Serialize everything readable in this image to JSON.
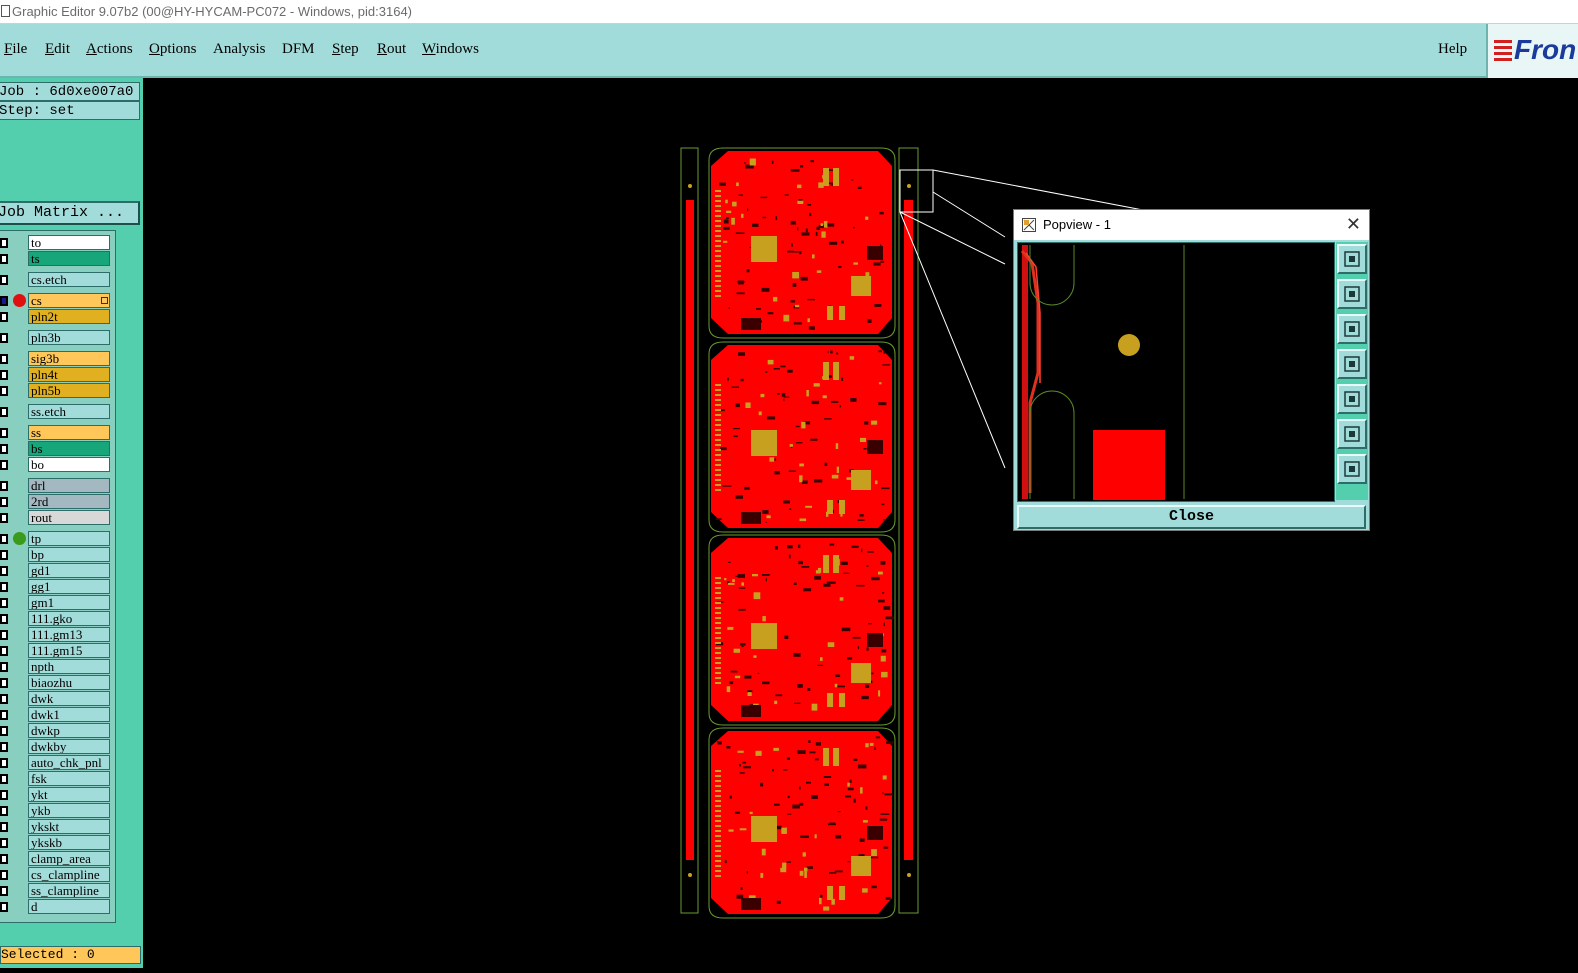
{
  "window": {
    "title": "Graphic Editor 9.07b2 (00@HY-HYCAM-PC072 - Windows, pid:3164)"
  },
  "menubar": {
    "items": [
      {
        "mnemonic": "F",
        "rest": "ile"
      },
      {
        "mnemonic": "E",
        "rest": "dit"
      },
      {
        "mnemonic": "A",
        "rest": "ctions"
      },
      {
        "mnemonic": "O",
        "rest": "ptions"
      },
      {
        "mnemonic": "",
        "rest": "Analysis"
      },
      {
        "mnemonic": "",
        "rest": "DFM"
      },
      {
        "mnemonic": "S",
        "rest": "tep"
      },
      {
        "mnemonic": "R",
        "rest": "out"
      },
      {
        "mnemonic": "W",
        "rest": "indows"
      }
    ],
    "help": "Help",
    "logo_text": "Fron"
  },
  "panel": {
    "job": "Job : 6d0xe007a0",
    "step": "Step: set",
    "job_matrix": "Job Matrix ...",
    "selected": "Selected : 0"
  },
  "layers": [
    {
      "name": "to",
      "color": "#ffffff"
    },
    {
      "name": "ts",
      "color": "#17a57a"
    },
    {
      "name": "cs.etch",
      "color": "#a2dcda"
    },
    {
      "name": "cs",
      "color": "#ffc75a",
      "dot": "#e01010",
      "active": true
    },
    {
      "name": "pln2t",
      "color": "#e0b020"
    },
    {
      "name": "pln3b",
      "color": "#a2dcda"
    },
    {
      "name": "sig3b",
      "color": "#ffc75a"
    },
    {
      "name": "pln4t",
      "color": "#e0b020"
    },
    {
      "name": "pln5b",
      "color": "#e0b020"
    },
    {
      "name": "ss.etch",
      "color": "#a2dcda"
    },
    {
      "name": "ss",
      "color": "#ffc75a"
    },
    {
      "name": "bs",
      "color": "#17a57a"
    },
    {
      "name": "bo",
      "color": "#ffffff"
    },
    {
      "name": "drl",
      "color": "#a3b8c0"
    },
    {
      "name": "2rd",
      "color": "#a3b8c0"
    },
    {
      "name": "rout",
      "color": "#d8d8d8"
    },
    {
      "name": "tp",
      "color": "#a2dcda",
      "dot": "#3a9a1a"
    },
    {
      "name": "bp",
      "color": "#a2dcda"
    },
    {
      "name": "gd1",
      "color": "#a2dcda"
    },
    {
      "name": "gg1",
      "color": "#a2dcda"
    },
    {
      "name": "gm1",
      "color": "#a2dcda"
    },
    {
      "name": "111.gko",
      "color": "#a2dcda"
    },
    {
      "name": "111.gm13",
      "color": "#a2dcda"
    },
    {
      "name": "111.gm15",
      "color": "#a2dcda"
    },
    {
      "name": "npth",
      "color": "#a2dcda"
    },
    {
      "name": "biaozhu",
      "color": "#a2dcda"
    },
    {
      "name": "dwk",
      "color": "#a2dcda"
    },
    {
      "name": "dwk1",
      "color": "#a2dcda"
    },
    {
      "name": "dwkp",
      "color": "#a2dcda"
    },
    {
      "name": "dwkby",
      "color": "#a2dcda"
    },
    {
      "name": "auto_chk_pnl",
      "color": "#a2dcda"
    },
    {
      "name": "fsk",
      "color": "#a2dcda"
    },
    {
      "name": "ykt",
      "color": "#a2dcda"
    },
    {
      "name": "ykb",
      "color": "#a2dcda"
    },
    {
      "name": "ykskt",
      "color": "#a2dcda"
    },
    {
      "name": "ykskb",
      "color": "#a2dcda"
    },
    {
      "name": "clamp_area",
      "color": "#a2dcda"
    },
    {
      "name": "cs_clampline",
      "color": "#a2dcda"
    },
    {
      "name": "ss_clampline",
      "color": "#a2dcda"
    },
    {
      "name": "d",
      "color": "#a2dcda"
    }
  ],
  "popview": {
    "title": "Popview - 1",
    "close_label": "Close",
    "tool_icons": [
      "zoom-home-icon",
      "pan-up-icon",
      "pan-down-icon",
      "pan-left-icon",
      "pan-right-icon",
      "zoom-out-icon",
      "zoom-in-icon"
    ]
  },
  "colors": {
    "copper": "#ff0000",
    "pad": "#c8a020",
    "outline": "#6a9a30",
    "panel": "#a2dcda"
  }
}
